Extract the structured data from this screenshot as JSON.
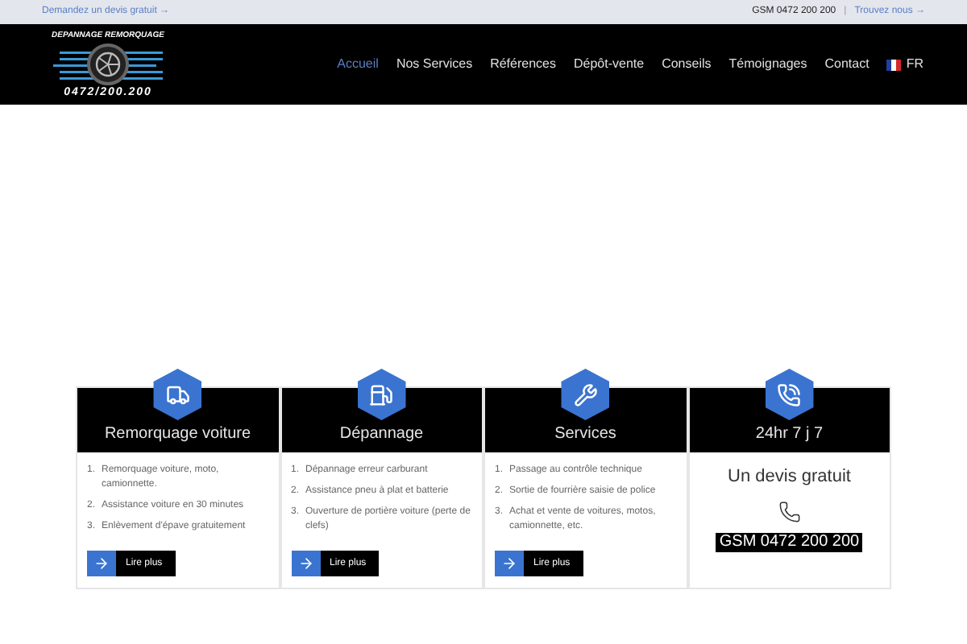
{
  "top_bar": {
    "quote_link": "Demandez un devis gratuit →",
    "phone": "GSM 0472 200 200",
    "separator": "|",
    "find_link": "Trouvez nous →"
  },
  "logo": {
    "title": "DEPANNAGE REMORQUAGE",
    "phone": "0472/200.200"
  },
  "nav": [
    {
      "label": "Accueil",
      "selected": true
    },
    {
      "label": "Nos Services",
      "selected": false
    },
    {
      "label": "Références",
      "selected": false
    },
    {
      "label": "Dépôt-vente",
      "selected": false
    },
    {
      "label": "Conseils",
      "selected": false
    },
    {
      "label": "Témoignages",
      "selected": false
    },
    {
      "label": "Contact",
      "selected": false
    }
  ],
  "language": {
    "label": "FR"
  },
  "cards": [
    {
      "kind": "list",
      "title": "Remorquage voiture",
      "items": [
        {
          "number": "1.",
          "text": "Remorquage voiture, moto, camionnette."
        },
        {
          "number": "2.",
          "text": "Assistance voiture en 30 minutes"
        },
        {
          "number": "3.",
          "text": "Enlèvement d'épave gratuitement"
        }
      ],
      "button": "Lire plus"
    },
    {
      "kind": "list",
      "title": "Dépannage",
      "items": [
        {
          "number": "1.",
          "text": "Dépannage erreur carburant"
        },
        {
          "number": "2.",
          "text": "Assistance pneu à plat et batterie"
        },
        {
          "number": "3.",
          "text": "Ouverture de portière voiture (perte de clefs)"
        }
      ],
      "button": "Lire plus"
    },
    {
      "kind": "list",
      "title": "Services",
      "items": [
        {
          "number": "1.",
          "text": "Passage au contrôle technique"
        },
        {
          "number": "2.",
          "text": "Sortie de fourrière saisie de police"
        },
        {
          "number": "3.",
          "text": "Achat et vente de voitures, motos, camionnette, etc."
        }
      ],
      "button": "Lire plus"
    },
    {
      "kind": "contact",
      "title": "24hr 7 j 7",
      "heading": "Un devis gratuit",
      "phone": "GSM 0472 200 200"
    }
  ]
}
